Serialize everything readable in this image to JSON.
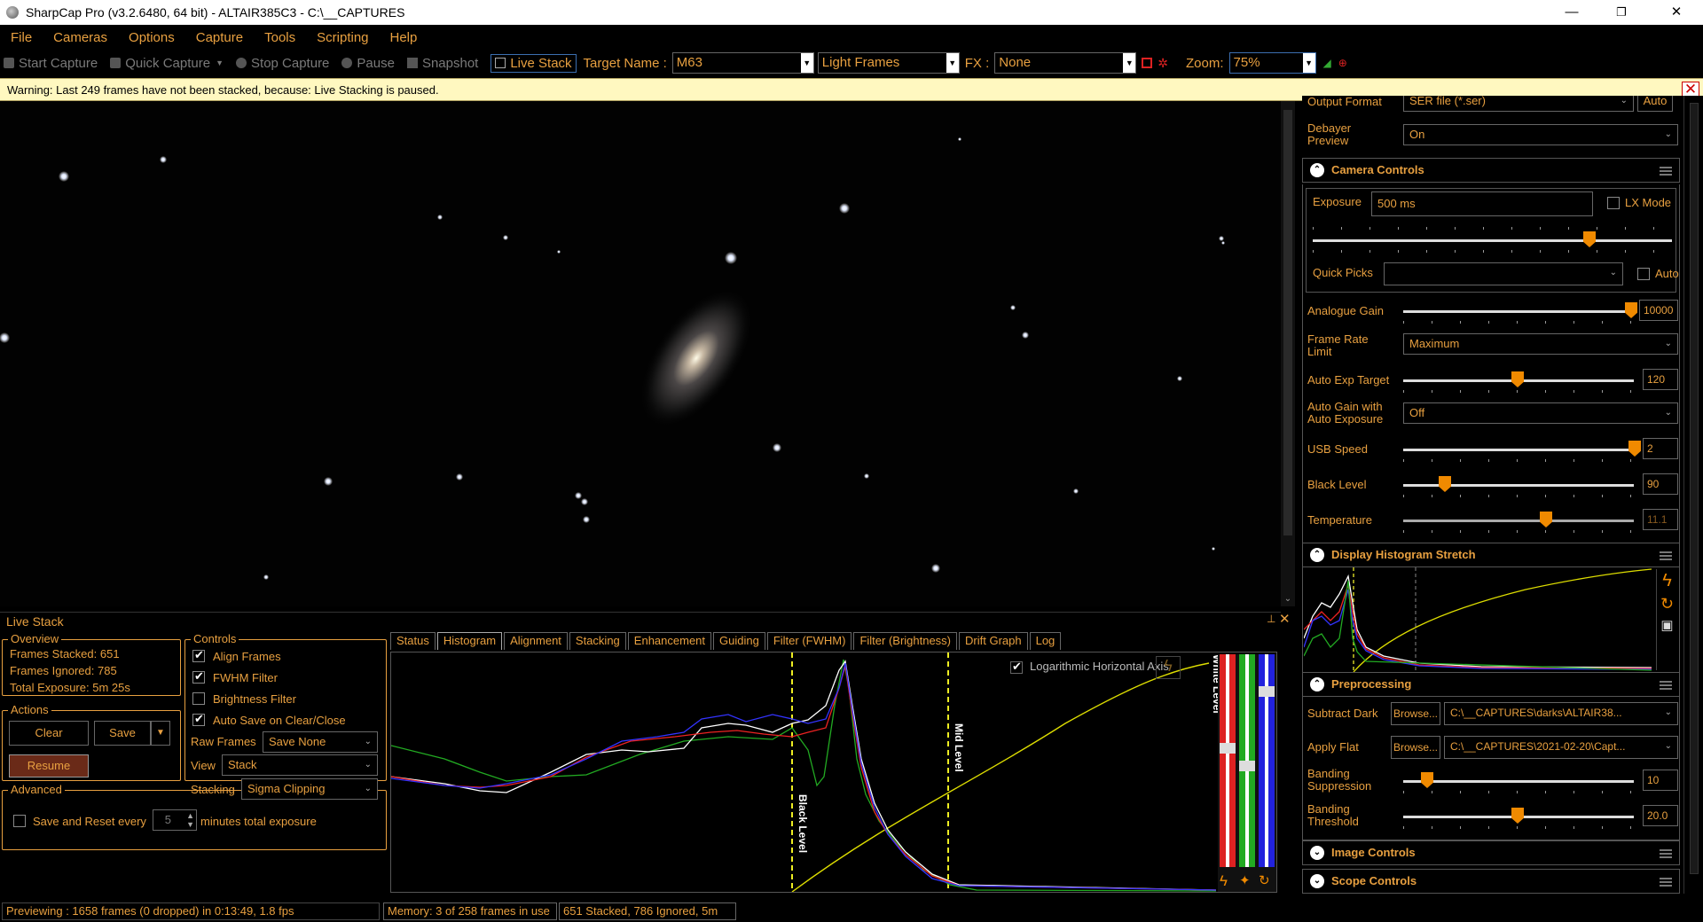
{
  "window": {
    "title": "SharpCap Pro (v3.2.6480, 64 bit) - ALTAIR385C3 - C:\\__CAPTURES",
    "min": "—",
    "max": "❐",
    "close": "✕"
  },
  "menu": [
    "File",
    "Cameras",
    "Options",
    "Capture",
    "Tools",
    "Scripting",
    "Help"
  ],
  "toolbar": {
    "start_capture": "Start Capture",
    "quick_capture": "Quick Capture",
    "stop_capture": "Stop Capture",
    "pause": "Pause",
    "snapshot": "Snapshot",
    "live_stack": "Live Stack",
    "target_label": "Target Name :",
    "target_value": "M63",
    "frame_type": "Light Frames",
    "fx_label": "FX :",
    "fx_value": "None",
    "zoom_label": "Zoom:",
    "zoom_value": "75%"
  },
  "warning": "Warning: Last 249 frames have not been stacked, because: Live Stacking is paused.",
  "right_panel": {
    "output_format_label": "Output Format",
    "output_format_value": "SER file (*.ser)",
    "output_auto": "Auto",
    "debayer_label": "Debayer Preview",
    "debayer_value": "On",
    "camera_controls": {
      "title": "Camera Controls",
      "exposure_label": "Exposure",
      "exposure_value": "500 ms",
      "lx_mode": "LX Mode",
      "quick_picks": "Quick Picks",
      "auto": "Auto",
      "analogue_gain_label": "Analogue Gain",
      "analogue_gain_value": "10000",
      "frame_rate_label": "Frame Rate Limit",
      "frame_rate_value": "Maximum",
      "auto_exp_label": "Auto Exp Target",
      "auto_exp_value": "120",
      "auto_gain_label": "Auto Gain with Auto Exposure",
      "auto_gain_value": "Off",
      "usb_label": "USB Speed",
      "usb_value": "2",
      "black_label": "Black Level",
      "black_value": "90",
      "temp_label": "Temperature",
      "temp_value": "11.1"
    },
    "display_histogram": {
      "title": "Display Histogram Stretch"
    },
    "preprocessing": {
      "title": "Preprocessing",
      "subtract_dark_label": "Subtract Dark",
      "browse": "Browse...",
      "dark_path": "C:\\__CAPTURES\\darks\\ALTAIR38...",
      "apply_flat_label": "Apply Flat",
      "flat_path": "C:\\__CAPTURES\\2021-02-20\\Capt...",
      "banding_supp_label": "Banding Suppression",
      "banding_supp_value": "10",
      "banding_thr_label": "Banding Threshold",
      "banding_thr_value": "20.0"
    },
    "image_controls": {
      "title": "Image Controls"
    },
    "scope_controls": {
      "title": "Scope Controls"
    }
  },
  "live_stack": {
    "title": "Live Stack",
    "overview": {
      "title": "Overview",
      "frames_stacked": "Frames Stacked:  651",
      "frames_ignored": "Frames Ignored:  785",
      "total_exposure": "Total Exposure:   5m 25s"
    },
    "actions": {
      "title": "Actions",
      "clear": "Clear",
      "save": "Save",
      "resume": "Resume"
    },
    "controls": {
      "title": "Controls",
      "align_frames": "Align Frames",
      "fwhm_filter": "FWHM Filter",
      "brightness_filter": "Brightness Filter",
      "auto_save": "Auto Save on Clear/Close",
      "raw_frames_label": "Raw Frames",
      "raw_frames_value": "Save None",
      "view_label": "View",
      "view_value": "Stack",
      "stacking_label": "Stacking",
      "stacking_value": "Sigma Clipping"
    },
    "advanced": {
      "title": "Advanced",
      "save_reset": "Save and Reset every",
      "minutes_value": "5",
      "minutes_label": "minutes total exposure"
    },
    "tabs": [
      "Status",
      "Histogram",
      "Alignment",
      "Stacking",
      "Enhancement",
      "Guiding",
      "Filter (FWHM)",
      "Filter (Brightness)",
      "Drift Graph",
      "Log"
    ],
    "active_tab": "Histogram",
    "histogram": {
      "log_axis": "Logarithmic Horizontal Axis",
      "black_level": "Black Level",
      "mid_level": "Mid Level",
      "white_level": "White Level"
    }
  },
  "status": {
    "previewing": "Previewing : 1658 frames (0 dropped) in 0:13:49, 1.8 fps",
    "memory": "Memory: 3 of 258 frames in use",
    "stacked": "651 Stacked, 786 Ignored, 5m"
  },
  "colors": {
    "accent": "#e8a040",
    "warning_bg": "#fff8c0",
    "slider_knob": "#f08a00"
  }
}
